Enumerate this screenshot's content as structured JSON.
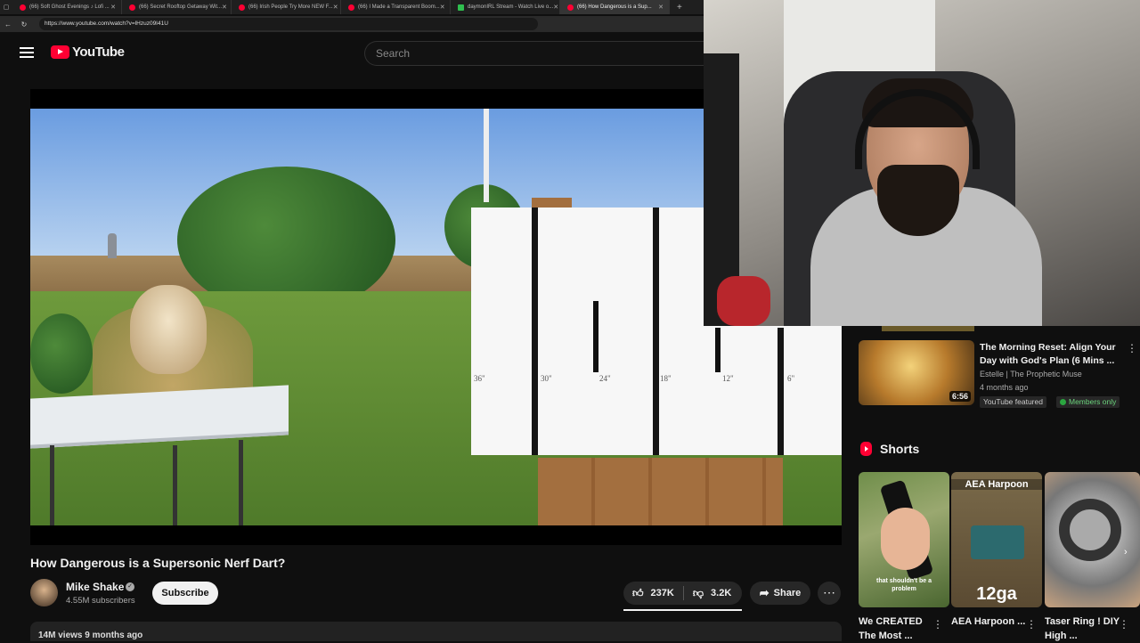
{
  "browser": {
    "tabs": [
      {
        "title": "(66) Soft Ghost Evenings ♪ Lofi ...",
        "active": false,
        "icon": "youtube"
      },
      {
        "title": "(66) Secret Rooftop Getaway Wit...",
        "active": false,
        "icon": "youtube"
      },
      {
        "title": "(66) Irish People Try More NEW F...",
        "active": false,
        "icon": "youtube"
      },
      {
        "title": "(66) I Made a Transparent Boom...",
        "active": false,
        "icon": "youtube"
      },
      {
        "title": "daymonIRL Stream - Watch Live o...",
        "active": false,
        "icon": "kick"
      },
      {
        "title": "(66) How Dangerous is a Sup...",
        "active": true,
        "icon": "youtube"
      }
    ],
    "new_tab": "+",
    "url": "https://www.youtube.com/watch?v=lHzuz09I41U"
  },
  "header": {
    "logo_text": "YouTube",
    "search_placeholder": "Search"
  },
  "video": {
    "board_labels": [
      "36\"",
      "30\"",
      "24\"",
      "18\"",
      "12\"",
      "6\""
    ],
    "title": "How Dangerous is a Supersonic Nerf Dart?",
    "channel": "Mike Shake",
    "subscribers": "4.55M subscribers",
    "subscribe_label": "Subscribe",
    "likes": "237K",
    "dislikes": "3.2K",
    "share_label": "Share",
    "views_line": "14M views  9 months ago"
  },
  "related": {
    "title": "The Morning Reset: Align Your Day with God's Plan (6 Mins ...",
    "channel": "Estelle | The Prophetic Muse",
    "age": "4 months ago",
    "duration": "6:56",
    "badge_featured": "YouTube featured",
    "badge_members": "Members only"
  },
  "shorts": {
    "heading": "Shorts",
    "items": [
      {
        "title": "We CREATED The Most ...",
        "overlay": "that shouldn't be a problem"
      },
      {
        "title": "AEA Harpoon ...",
        "overlay_top": "AEA Harpoon",
        "overlay_bottom": "12ga"
      },
      {
        "title": "Taser Ring ! DIY High ...",
        "overlay": ""
      }
    ]
  },
  "colors": {
    "background": "#0f0f0f",
    "youtube_red": "#ff0033",
    "members_green": "#2ba640"
  }
}
